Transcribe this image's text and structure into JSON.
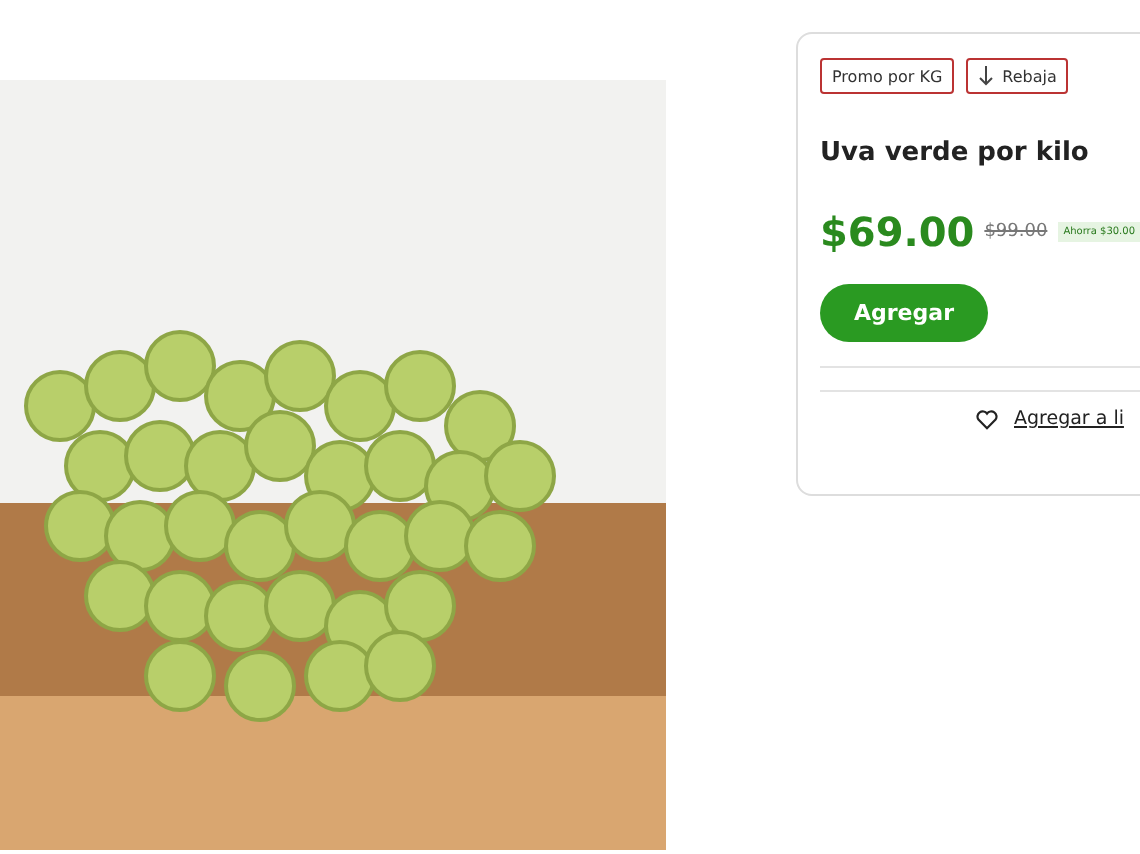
{
  "tags": [
    {
      "label": "Promo por KG",
      "kind": "plain"
    },
    {
      "label": "Rebaja",
      "kind": "down"
    }
  ],
  "product": {
    "name": "Uva verde por kilo",
    "price": "$69.00",
    "old_price": "$99.00",
    "savings": "Ahorra $30.00"
  },
  "add_button": "Agregar",
  "list_link": "Agregar a li"
}
